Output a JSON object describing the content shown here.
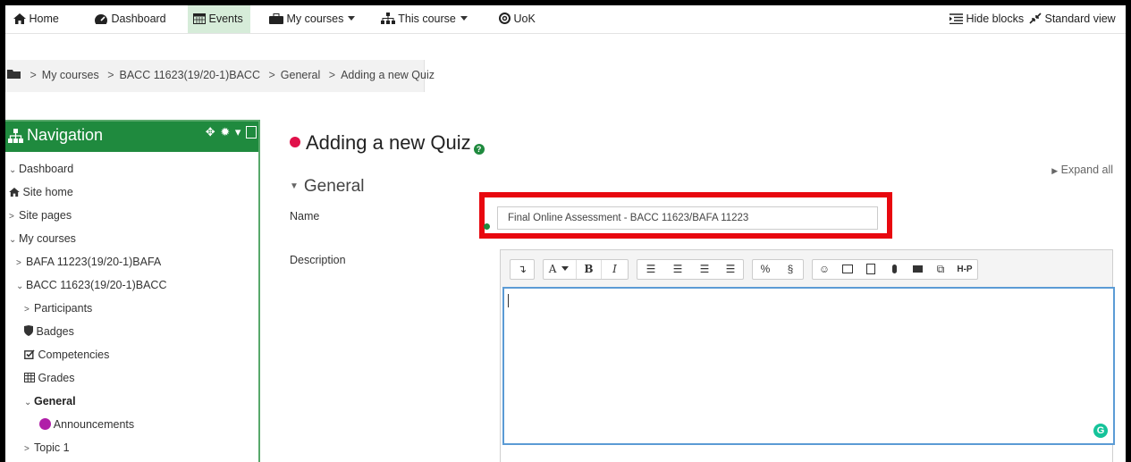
{
  "navbar": {
    "home": "Home",
    "dashboard": "Dashboard",
    "events": "Events",
    "my_courses": "My courses",
    "this_course": "This course",
    "uok": "UoK",
    "hide_blocks": "Hide blocks",
    "standard_view": "Standard view"
  },
  "breadcrumb": [
    "My courses",
    "BACC 11623(19/20-1)BACC",
    "General",
    "Adding a new Quiz"
  ],
  "navigation": {
    "title": "Navigation",
    "items": [
      {
        "label": "Dashboard",
        "prefix": "v",
        "icon": ""
      },
      {
        "label": "Site home",
        "prefix": "",
        "icon": "home-icon"
      },
      {
        "label": "Site pages",
        "prefix": ">",
        "icon": ""
      },
      {
        "label": "My courses",
        "prefix": "v",
        "icon": ""
      },
      {
        "label": "BAFA 11223(19/20-1)BAFA",
        "prefix": ">",
        "icon": ""
      },
      {
        "label": "BACC 11623(19/20-1)BACC",
        "prefix": "v",
        "icon": ""
      },
      {
        "label": "Participants",
        "prefix": ">",
        "icon": ""
      },
      {
        "label": "Badges",
        "prefix": "",
        "icon": "shield-icon"
      },
      {
        "label": "Competencies",
        "prefix": "",
        "icon": "checkbox-icon"
      },
      {
        "label": "Grades",
        "prefix": "",
        "icon": "table-icon"
      },
      {
        "label": "General",
        "prefix": "v",
        "icon": ""
      },
      {
        "label": "Announcements",
        "prefix": "",
        "icon": "forum-icon"
      },
      {
        "label": "Topic 1",
        "prefix": ">",
        "icon": ""
      }
    ]
  },
  "main": {
    "title": "Adding a new Quiz",
    "expand_all": "Expand all",
    "section": "General",
    "name_label": "Name",
    "name_value": "Final Online Assessment - BACC 11623/BAFA 11223",
    "description_label": "Description"
  },
  "editor": {
    "font_glyph": "A",
    "bold": "B",
    "italic": "I",
    "h5p": "H-P",
    "grammarly": "G"
  },
  "colors": {
    "accent": "#1f8a3e",
    "highlight": "#e8080f",
    "editor_focus": "#5b9bd5"
  }
}
